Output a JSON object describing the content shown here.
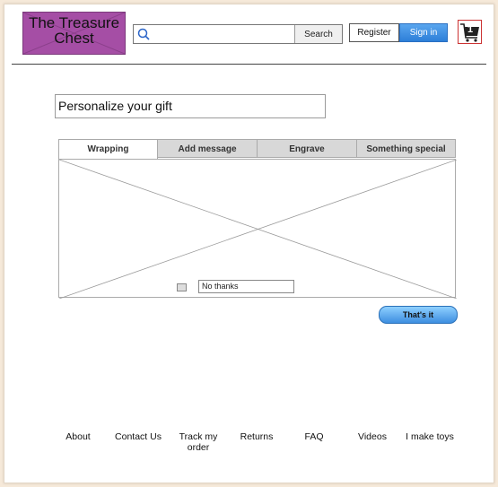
{
  "header": {
    "logo_text": "The Treasure Chest",
    "search": {
      "placeholder": "",
      "value": "",
      "button_label": "Search"
    },
    "register_label": "Register",
    "signin_label": "Sign in",
    "cart_count": "1"
  },
  "main": {
    "title": "Personalize your gift",
    "tabs": [
      {
        "label": "Wrapping",
        "active": true
      },
      {
        "label": "Add message",
        "active": false
      },
      {
        "label": "Engrave",
        "active": false
      },
      {
        "label": "Something special",
        "active": false
      }
    ],
    "no_thanks_label": "No thanks",
    "confirm_label": "That's it"
  },
  "footer": {
    "links": [
      "About",
      "Contact Us",
      "Track my order",
      "Returns",
      "FAQ",
      "Videos",
      "I make toys"
    ]
  },
  "colors": {
    "logo_bg": "#a54ea5",
    "signin_bg": "#2d7fd8",
    "confirm_bg": "#3d8ee0",
    "page_bg": "#f6e9d9"
  }
}
